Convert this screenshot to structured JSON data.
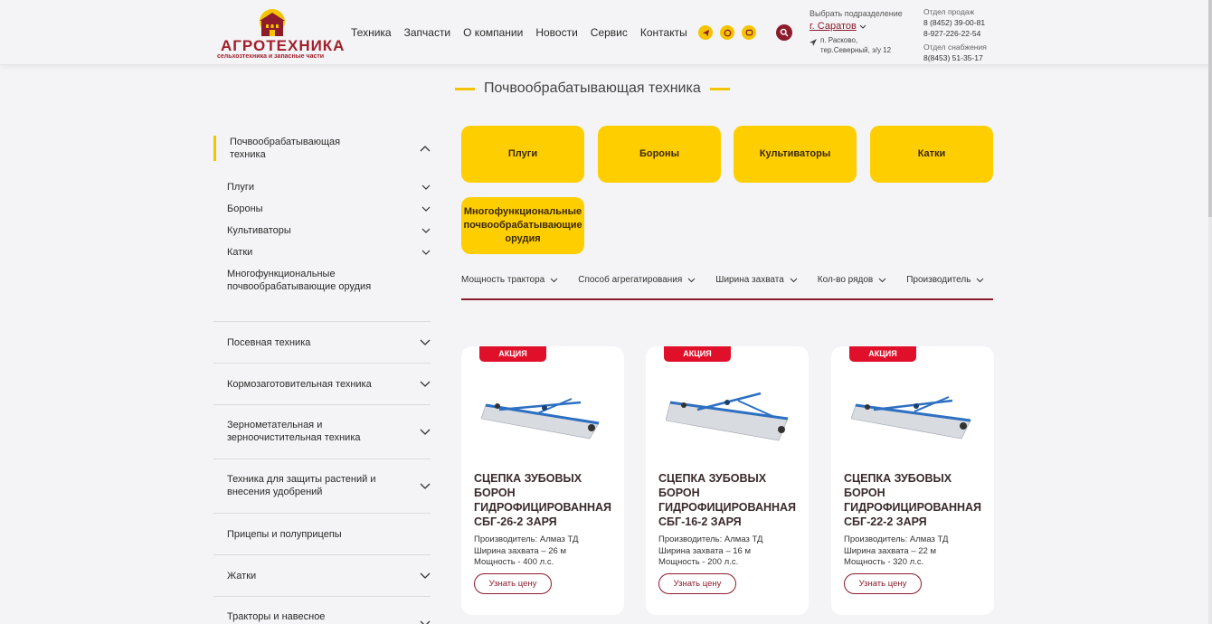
{
  "brand": {
    "name": "АГРОТЕХНИКА",
    "tagline": "сельхозтехника и запасные части"
  },
  "nav": [
    "Техника",
    "Запчасти",
    "О компании",
    "Новости",
    "Сервис",
    "Контакты"
  ],
  "social_icons": [
    "telegram-icon",
    "whatsapp-icon",
    "viber-icon"
  ],
  "region": {
    "label": "Выбрать подразделение",
    "city": "г. Саратов",
    "address_line1": "п. Расково,",
    "address_line2": "тер.Северный, з/у 12"
  },
  "contacts": {
    "sales_label": "Отдел продаж",
    "sales_phone1": "8 (8452) 39-00-81",
    "sales_phone2": "8-927-226-22-54",
    "supply_label": "Отдел снабжения",
    "supply_phone": "8(8453) 51-35-17"
  },
  "section_title": "Почвообрабатывающая техника",
  "sidebar": {
    "active": "Почвообрабатывающая техника",
    "subitems": [
      "Плуги",
      "Бороны",
      "Культиваторы",
      "Катки"
    ],
    "sub_multi": "Многофункциональные почвообрабатывающие орудия",
    "categories": [
      "Посевная техника",
      "Кормозаготовительная техника",
      "Зернометательная и зерноочистительная техника",
      "Техника для защиты растений и внесения удобрений",
      "Прицепы и полуприцепы",
      "Жатки",
      "Тракторы и навесное"
    ]
  },
  "category_buttons": [
    "Плуги",
    "Бороны",
    "Культиваторы",
    "Катки",
    "Многофункциональные почвообрабатывающие орудия"
  ],
  "filters": [
    "Мощность трактора",
    "Способ агрегатирования",
    "Ширина захвата",
    "Кол-во рядов",
    "Производитель"
  ],
  "products": [
    {
      "badge": "АКЦИЯ",
      "title": "Сцепка зубовых борон гидрофицированная СБГ-26-2 Заря",
      "maker": "Производитель: Алмаз ТД",
      "width": "Ширина захвата – 26 м",
      "power": "Мощность - 400 л.с.",
      "button": "Узнать цену"
    },
    {
      "badge": "АКЦИЯ",
      "title": "Сцепка зубовых борон гидрофицированная СБГ-16-2 Заря",
      "maker": "Производитель: Алмаз ТД",
      "width": "Ширина захвата – 16 м",
      "power": "Мощность - 200 л.с.",
      "button": "Узнать цену"
    },
    {
      "badge": "АКЦИЯ",
      "title": "Сцепка зубовых борон гидрофицированная СБГ-22-2 Заря",
      "maker": "Производитель: Алмаз ТД",
      "width": "Ширина захвата – 22 м",
      "power": "Мощность - 320 л.с.",
      "button": "Узнать цену"
    }
  ],
  "colors": {
    "accent_yellow": "#ffce00",
    "brand_red": "#8c1b2c",
    "badge_red": "#e0102a"
  }
}
